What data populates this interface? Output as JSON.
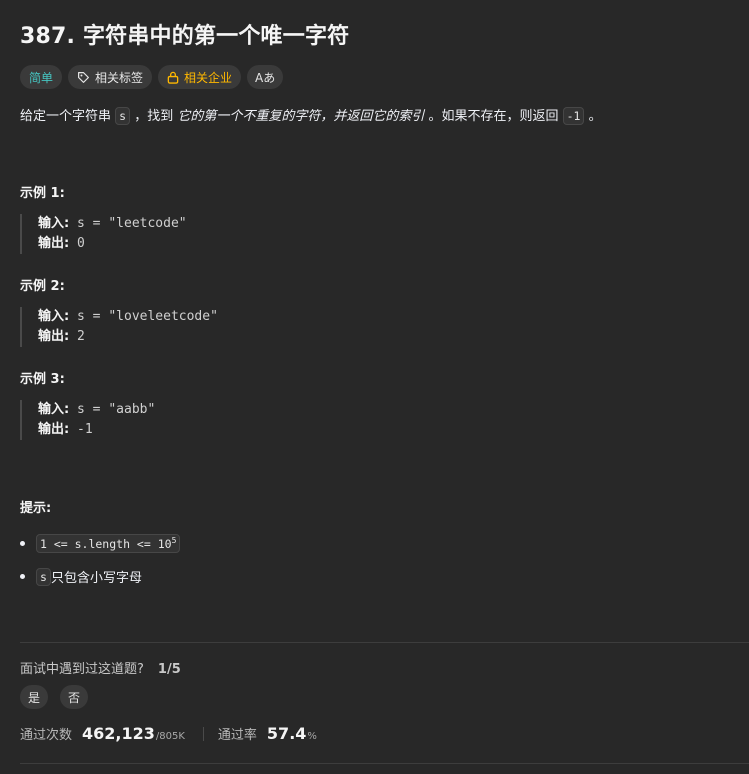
{
  "problem": {
    "title": "387. 字符串中的第一个唯一字符",
    "tags": {
      "difficulty": "简单",
      "related_tags": "相关标签",
      "related_companies": "相关企业",
      "translate": "Aあ"
    },
    "description": {
      "part1": "给定一个字符串 ",
      "code_s": "s",
      "part2": " ，找到 ",
      "italic": "它的第一个不重复的字符，并返回它的索引",
      "part3": " 。如果不存在，则返回 ",
      "code_neg1": "-1",
      "part4": " 。"
    },
    "examples": [
      {
        "title": "示例 1:",
        "input_label": "输入:",
        "input": " s = \"leetcode\"",
        "output_label": "输出:",
        "output": " 0"
      },
      {
        "title": "示例 2:",
        "input_label": "输入:",
        "input": " s = \"loveleetcode\"",
        "output_label": "输出:",
        "output": " 2"
      },
      {
        "title": "示例 3:",
        "input_label": "输入:",
        "input": " s = \"aabb\"",
        "output_label": "输出:",
        "output": " -1"
      }
    ],
    "hints": {
      "title": "提示:",
      "constraint1_code": "1 <= s.length <= 10",
      "constraint1_sup": "5",
      "constraint2_code": "s",
      "constraint2_text": " 只包含小写字母"
    }
  },
  "interview": {
    "question": "面试中遇到过这道题?",
    "fraction": "1/5",
    "yes": "是",
    "no": "否"
  },
  "stats": {
    "accepted_label": "通过次数",
    "accepted_value": "462,123",
    "submissions": "/805K",
    "rate_label": "通过率",
    "rate_value": "57.4",
    "rate_unit": "%"
  },
  "colors": {
    "background": "#282828",
    "easy": "#46c6c2",
    "company": "#ffb800"
  }
}
